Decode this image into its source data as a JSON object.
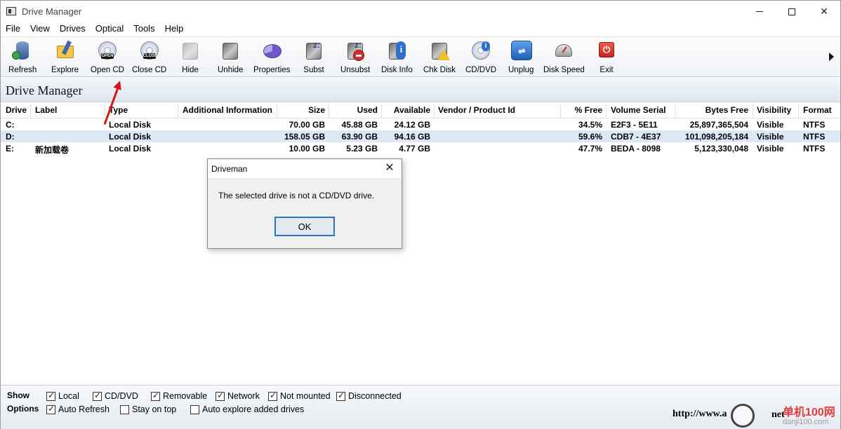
{
  "window": {
    "title": "Drive Manager"
  },
  "menu": [
    "File",
    "View",
    "Drives",
    "Optical",
    "Tools",
    "Help"
  ],
  "toolbar": [
    {
      "label": "Refresh",
      "icon": "refresh-icon"
    },
    {
      "label": "Explore",
      "icon": "explore-icon"
    },
    {
      "label": "Open CD",
      "icon": "open-cd-icon",
      "badge": "OPEN"
    },
    {
      "label": "Close CD",
      "icon": "close-cd-icon",
      "badge": "CLOSE"
    },
    {
      "label": "Hide",
      "icon": "hide-icon"
    },
    {
      "label": "Unhide",
      "icon": "unhide-icon"
    },
    {
      "label": "Properties",
      "icon": "properties-icon"
    },
    {
      "label": "Subst",
      "icon": "subst-icon"
    },
    {
      "label": "Unsubst",
      "icon": "unsubst-icon"
    },
    {
      "label": "Disk Info",
      "icon": "disk-info-icon"
    },
    {
      "label": "Chk Disk",
      "icon": "chk-disk-icon"
    },
    {
      "label": "CD/DVD",
      "icon": "cd-dvd-icon"
    },
    {
      "label": "Unplug",
      "icon": "unplug-icon"
    },
    {
      "label": "Disk Speed",
      "icon": "disk-speed-icon"
    },
    {
      "label": "Exit",
      "icon": "exit-icon"
    }
  ],
  "section_title": "Drive Manager",
  "table": {
    "columns": [
      "Drive",
      "Label",
      "Type",
      "Additional Information",
      "Size",
      "Used",
      "Available",
      "Vendor / Product Id",
      "% Free",
      "Volume Serial",
      "Bytes Free",
      "Visibility",
      "Format"
    ],
    "rows": [
      {
        "drive": "C:",
        "label": "",
        "type": "Local Disk",
        "info": "",
        "size": "70.00 GB",
        "used": "45.88 GB",
        "available": "24.12 GB",
        "vendor": "",
        "free_pct": "34.5%",
        "serial": "E2F3 - 5E11",
        "bytes_free": "25,897,365,504",
        "visibility": "Visible",
        "format": "NTFS"
      },
      {
        "drive": "D:",
        "label": "",
        "type": "Local Disk",
        "info": "",
        "size": "158.05 GB",
        "used": "63.90 GB",
        "available": "94.16 GB",
        "vendor": "",
        "free_pct": "59.6%",
        "serial": "CDB7 - 4E37",
        "bytes_free": "101,098,205,184",
        "visibility": "Visible",
        "format": "NTFS"
      },
      {
        "drive": "E:",
        "label": "新加载卷",
        "type": "Local Disk",
        "info": "",
        "size": "10.00 GB",
        "used": "5.23 GB",
        "available": "4.77 GB",
        "vendor": "",
        "free_pct": "47.7%",
        "serial": "BEDA - 8098",
        "bytes_free": "5,123,330,048",
        "visibility": "Visible",
        "format": "NTFS"
      }
    ],
    "selected_row": 1
  },
  "dialog": {
    "title": "Driveman",
    "message": "The selected drive is not a CD/DVD drive.",
    "ok_label": "OK"
  },
  "footer": {
    "show_label": "Show",
    "options_label": "Options",
    "show_filters": [
      {
        "label": "Local",
        "checked": true
      },
      {
        "label": "CD/DVD",
        "checked": true
      },
      {
        "label": "Removable",
        "checked": true
      },
      {
        "label": "Network",
        "checked": true
      },
      {
        "label": "Not mounted",
        "checked": true
      },
      {
        "label": "Disconnected",
        "checked": true
      }
    ],
    "options": [
      {
        "label": "Auto Refresh",
        "checked": true
      },
      {
        "label": "Stay on top",
        "checked": false
      },
      {
        "label": "Auto explore added drives",
        "checked": false
      }
    ],
    "url": "http://www.a",
    "url_suffix": "net",
    "watermark_cn": "单机100网",
    "watermark_domain": "danji100.com"
  },
  "colors": {
    "selected_row": "#dde8f7",
    "annotation_arrow": "#d81515",
    "dialog_button_border": "#2b73c8"
  }
}
